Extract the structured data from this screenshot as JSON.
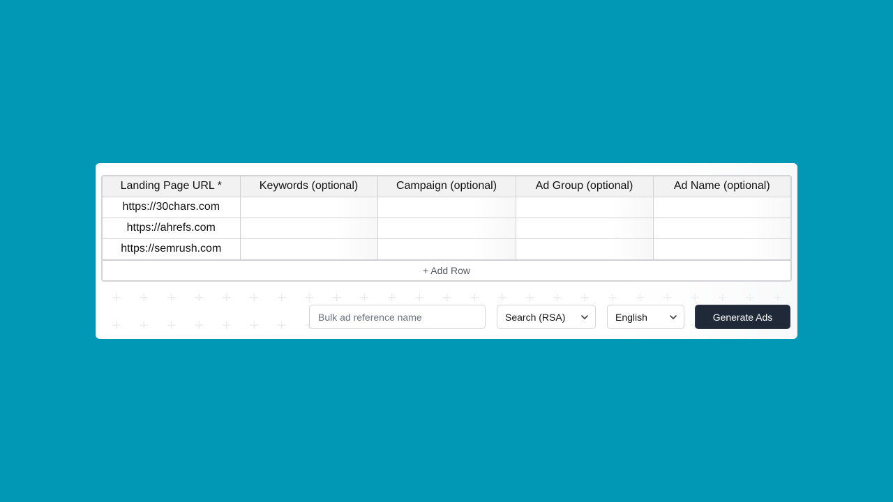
{
  "table": {
    "headers": [
      "Landing Page URL *",
      "Keywords (optional)",
      "Campaign (optional)",
      "Ad Group (optional)",
      "Ad Name (optional)"
    ],
    "rows": [
      [
        "https://30chars.com",
        "",
        "",
        "",
        ""
      ],
      [
        "https://ahrefs.com",
        "",
        "",
        "",
        ""
      ],
      [
        "https://semrush.com",
        "",
        "",
        "",
        ""
      ]
    ],
    "add_row_label": "+ Add Row"
  },
  "controls": {
    "reference_name": {
      "value": "",
      "placeholder": "Bulk ad reference name"
    },
    "ad_type": {
      "selected": "Search (RSA)"
    },
    "language": {
      "selected": "English"
    },
    "generate_label": "Generate Ads"
  },
  "colors": {
    "page_background": "#0098b4",
    "primary_button": "#1f2937"
  }
}
